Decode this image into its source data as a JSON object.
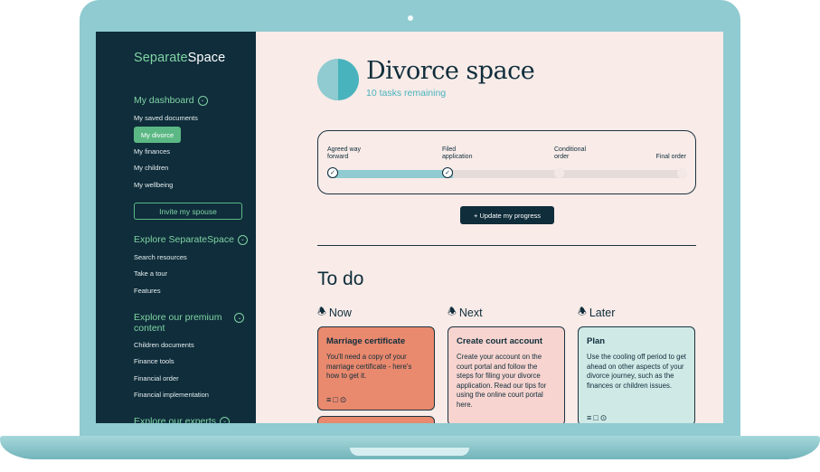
{
  "sidebar": {
    "logo_part1": "Separate",
    "logo_part2": "Space",
    "dashboard_heading": "My dashboard",
    "dashboard_items": [
      "My saved documents",
      "My divorce",
      "My finances",
      "My children",
      "My wellbeing"
    ],
    "invite_label": "Invite my spouse",
    "explore_heading": "Explore SeparateSpace",
    "explore_items": [
      "Search resources",
      "Take a tour",
      "Features"
    ],
    "premium_heading_line1": "Explore our premium",
    "premium_heading_line2": "content",
    "premium_items": [
      "Children documents",
      "Finance tools",
      "Financial order",
      "Financial implementation"
    ],
    "experts_heading": "Explore our experts"
  },
  "main": {
    "title": "Divorce space",
    "subtitle": "10 tasks remaining",
    "progress": {
      "stages": [
        {
          "line1": "Agreed way",
          "line2": "forward",
          "status": "done"
        },
        {
          "line1": "Filed",
          "line2": "application",
          "status": "done"
        },
        {
          "line1": "Conditional",
          "line2": "order",
          "status": "todo"
        },
        {
          "line1": "Final order",
          "line2": "",
          "status": "todo"
        }
      ],
      "fraction_complete": 0.35
    },
    "update_button": "+ Update my progress",
    "todo_heading": "To do",
    "columns": [
      {
        "label": "Now",
        "card_title": "Marriage certificate",
        "card_body": "You'll need a copy of your marriage certificate - here's how to get it."
      },
      {
        "label": "Next",
        "card_title": "Create court account",
        "card_body": "Create your account on the court portal and follow the steps for filing your divorce application.  Read our tips for using the online court portal here."
      },
      {
        "label": "Later",
        "card_title": "Plan",
        "card_body": "Use the cooling off period to get ahead on other aspects of your divorce journey, such as the finances or children issues."
      }
    ]
  },
  "colors": {
    "sidebar_bg": "#0f2d3b",
    "accent_green": "#5bb884",
    "accent_teal": "#49b3bd",
    "page_bg": "#f8ebe8",
    "now_card": "#e9896e",
    "next_card": "#f7d4cf",
    "later_card": "#cfe9e6"
  },
  "icons": {
    "section_toggle": "chevron-down-circle-icon",
    "column_now": "bell-ringing-icon",
    "column_next": "bell-icon",
    "column_later": "bell-snooze-icon",
    "card_actions": [
      "notes-icon",
      "comment-icon",
      "attachment-icon"
    ]
  }
}
